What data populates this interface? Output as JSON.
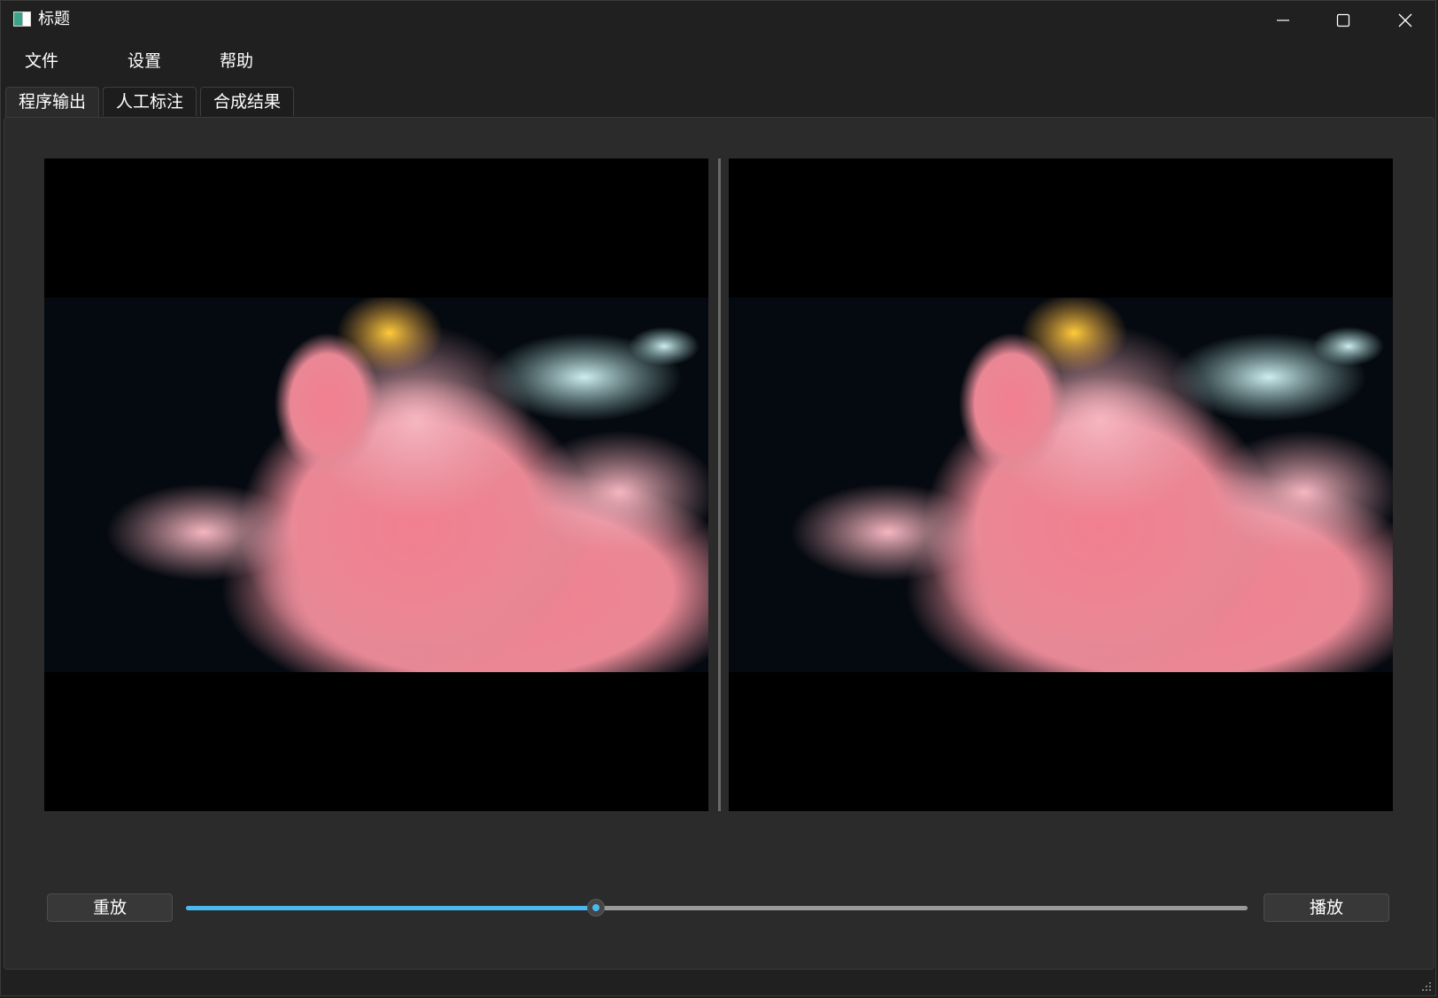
{
  "window": {
    "title": "标题"
  },
  "menu": {
    "items": [
      "文件",
      "设置",
      "帮助"
    ]
  },
  "tabs": [
    {
      "label": "程序输出",
      "active": true
    },
    {
      "label": "人工标注",
      "active": false
    },
    {
      "label": "合成结果",
      "active": false
    }
  ],
  "player": {
    "replay_label": "重放",
    "play_label": "播放",
    "progress_fraction": 0.386
  },
  "colors": {
    "accent": "#4cb8f0",
    "background": "#202020",
    "panel": "#2b2b2b"
  },
  "icons": {
    "minimize": "minimize-icon",
    "maximize": "maximize-icon",
    "close": "close-icon",
    "app": "app-window-icon",
    "grip": "resize-grip-icon"
  }
}
